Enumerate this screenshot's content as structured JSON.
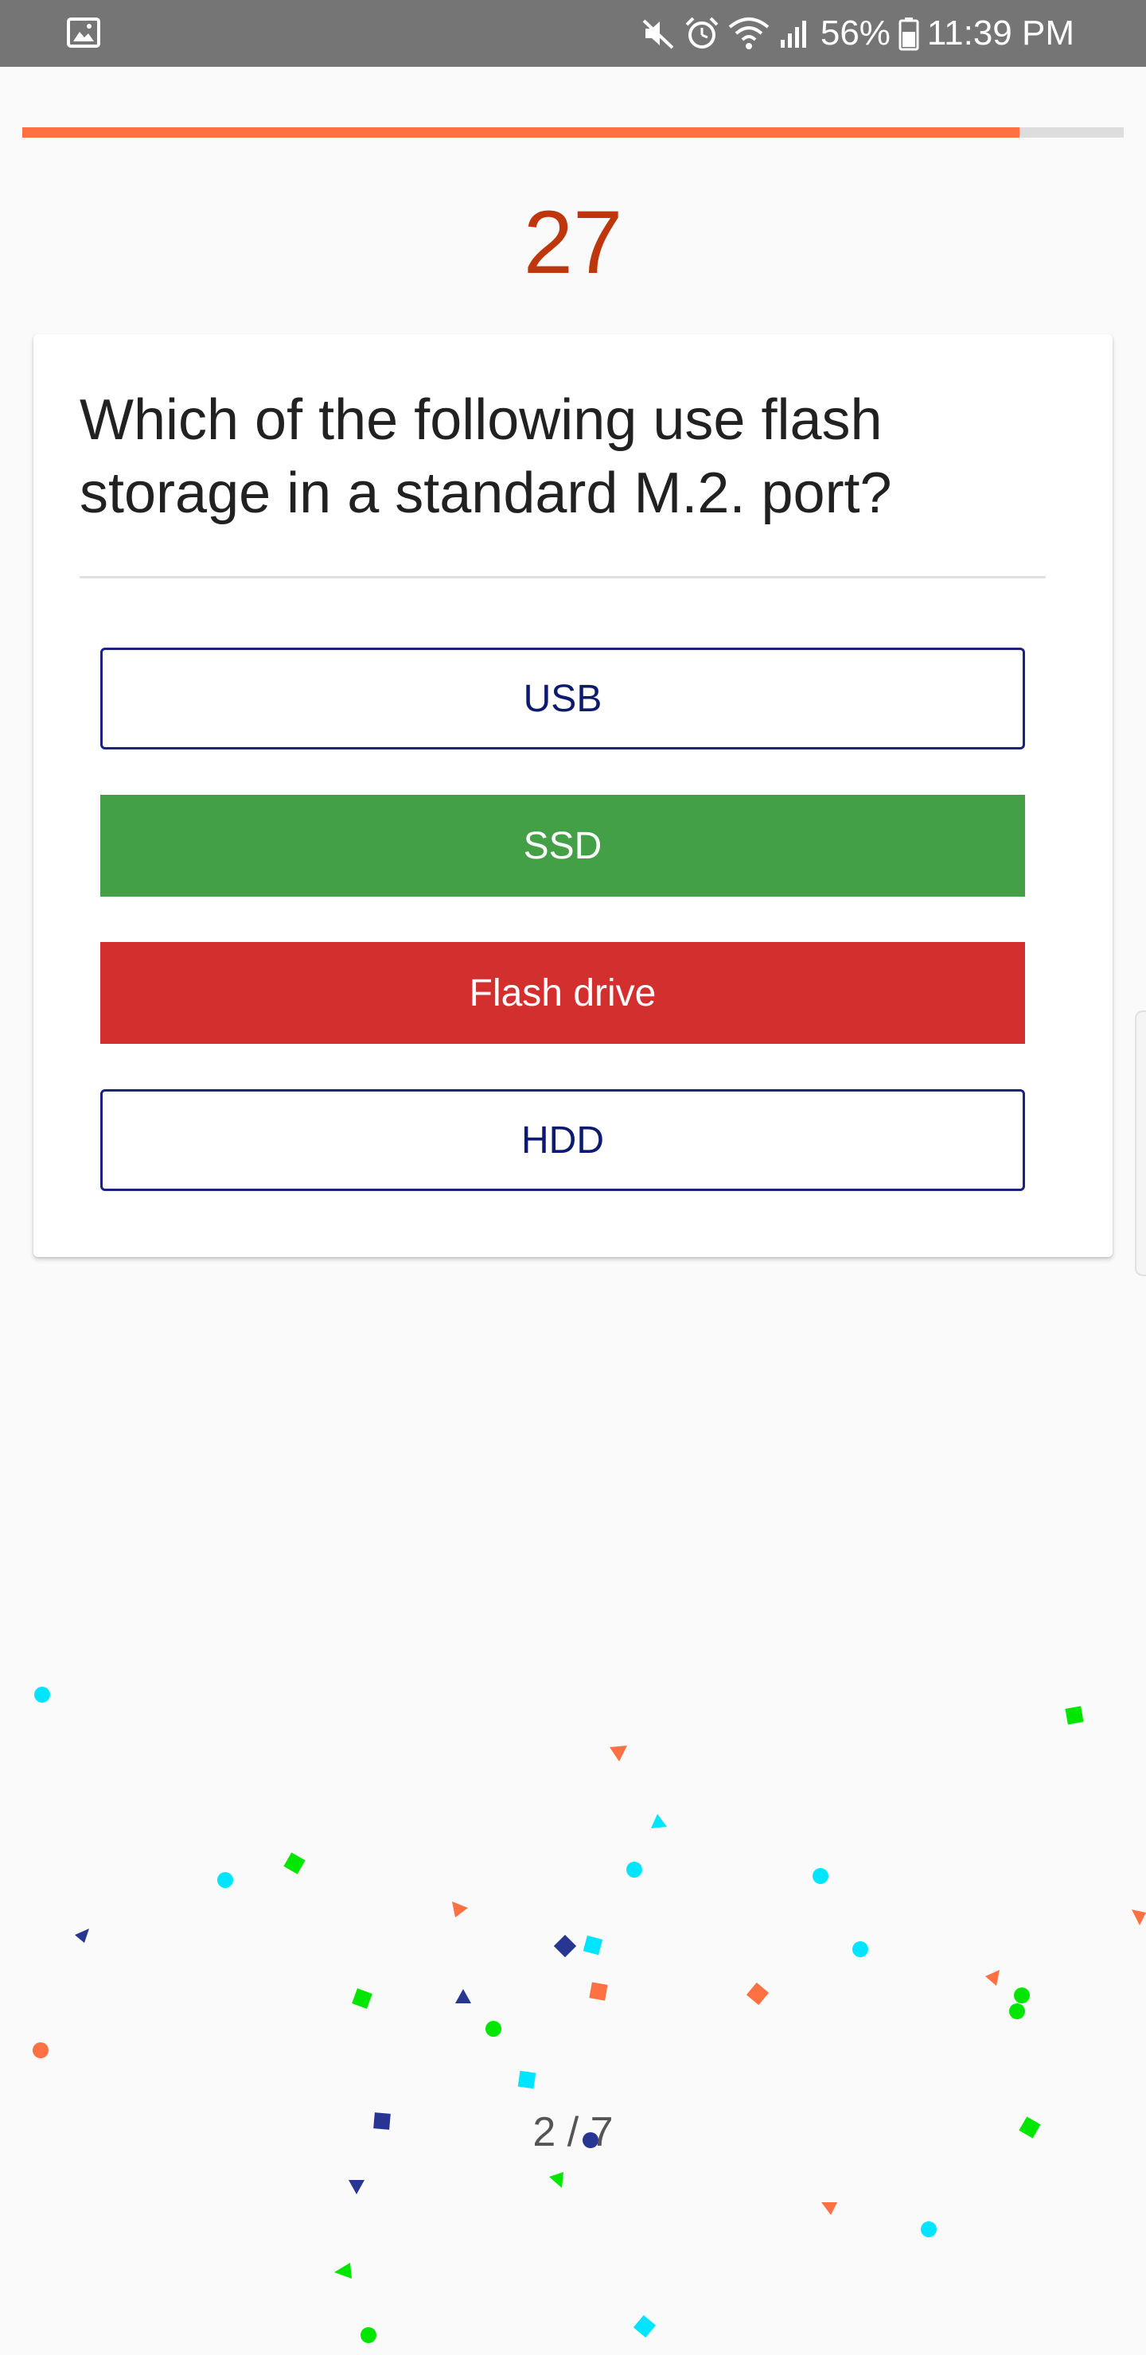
{
  "status_bar": {
    "battery": "56%",
    "time": "11:39 PM",
    "icons": [
      "gallery-icon",
      "mute-icon",
      "alarm-icon",
      "wifi-icon",
      "signal-icon",
      "battery-icon"
    ]
  },
  "progress": {
    "fraction": 0.905
  },
  "score": "27",
  "question": {
    "text": "Which of the following use flash storage in a standard M.2. port?"
  },
  "answers": [
    {
      "label": "USB",
      "state": "unselected"
    },
    {
      "label": "SSD",
      "state": "correct"
    },
    {
      "label": "Flash drive",
      "state": "incorrect"
    },
    {
      "label": "HDD",
      "state": "unselected"
    }
  ],
  "pager": {
    "text": "2 / 7"
  },
  "colors": {
    "status_bar": "#757575",
    "progress": "#ff7043",
    "score": "#bf360c",
    "correct": "#43a047",
    "incorrect": "#d32f2f",
    "outline": "#1a237e",
    "confetti": [
      "#00e5ff",
      "#00e600",
      "#ff7043",
      "#283593"
    ]
  }
}
